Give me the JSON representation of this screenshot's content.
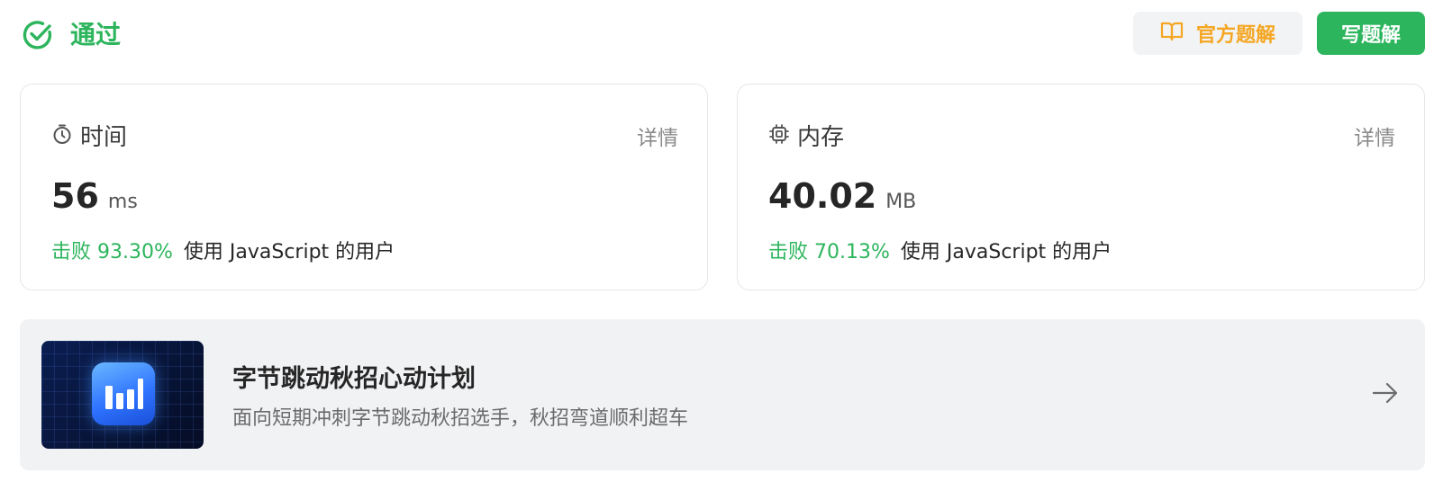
{
  "header": {
    "status_text": "通过",
    "status_color": "#2db55d",
    "official_solution_label": "官方题解",
    "write_solution_label": "写题解"
  },
  "time_card": {
    "title": "时间",
    "detail_label": "详情",
    "value": "56",
    "unit": "ms",
    "beat_text": "击败 93.30%",
    "beat_desc": "使用 JavaScript 的用户",
    "icon": "stopwatch-icon"
  },
  "memory_card": {
    "title": "内存",
    "detail_label": "详情",
    "value": "40.02",
    "unit": "MB",
    "beat_text": "击败 70.13%",
    "beat_desc": "使用 JavaScript 的用户",
    "icon": "chip-icon"
  },
  "banner": {
    "title": "字节跳动秋招心动计划",
    "subtitle": "面向短期冲刺字节跳动秋招选手，秋招弯道顺利超车",
    "icon": "arrow-right-icon"
  },
  "colors": {
    "accent_green": "#2db55d",
    "accent_orange": "#f5a623"
  }
}
